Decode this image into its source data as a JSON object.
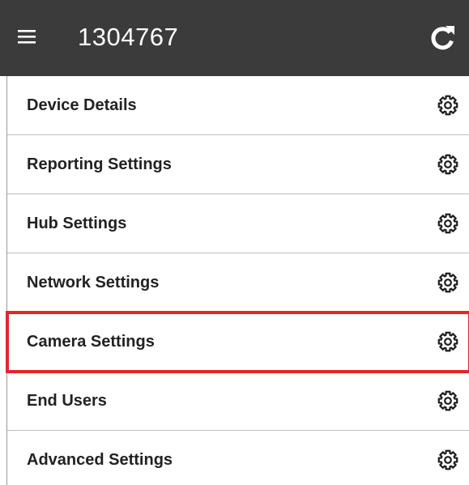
{
  "header": {
    "title": "1304767",
    "menu_icon": "hamburger-menu-icon",
    "refresh_icon": "refresh-icon",
    "background_color": "#3b3b3b"
  },
  "settings_list": {
    "items": [
      {
        "label": "Device Details",
        "icon": "gear-icon",
        "highlighted": false
      },
      {
        "label": "Reporting Settings",
        "icon": "gear-icon",
        "highlighted": false
      },
      {
        "label": "Hub Settings",
        "icon": "gear-icon",
        "highlighted": false
      },
      {
        "label": "Network Settings",
        "icon": "gear-icon",
        "highlighted": false
      },
      {
        "label": "Camera Settings",
        "icon": "gear-icon",
        "highlighted": true
      },
      {
        "label": "End Users",
        "icon": "gear-icon",
        "highlighted": false
      },
      {
        "label": "Advanced Settings",
        "icon": "gear-icon",
        "highlighted": false
      }
    ],
    "highlight_color": "#e3262e"
  }
}
